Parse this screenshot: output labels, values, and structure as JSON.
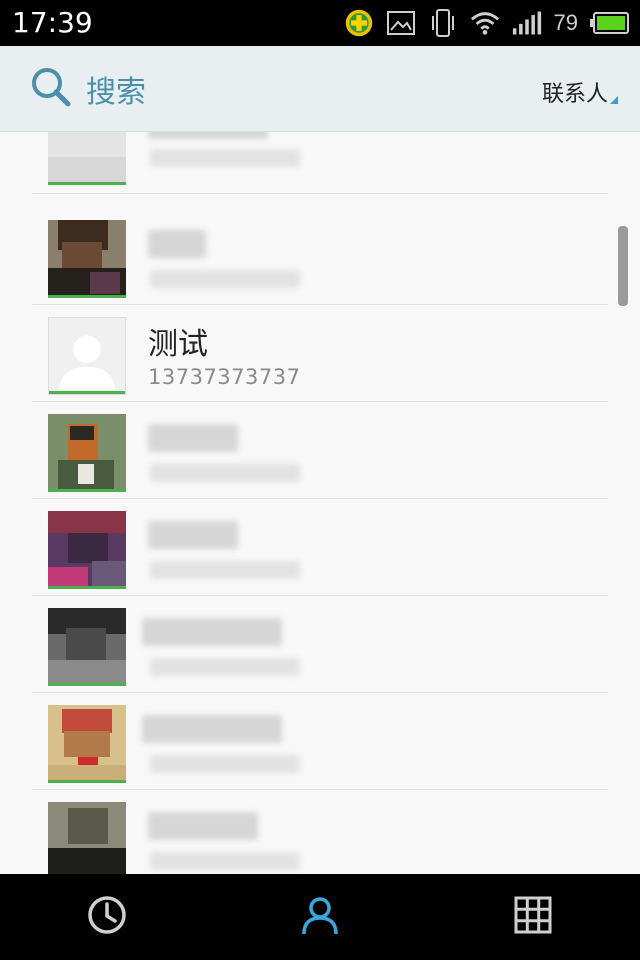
{
  "status_bar": {
    "time": "17:39",
    "battery_level": "79",
    "icons": [
      "security-app-icon",
      "image-icon",
      "vibrate-icon",
      "wifi-icon",
      "signal-icon",
      "battery-icon"
    ]
  },
  "header": {
    "search_label": "搜索",
    "filter_label": "联系人",
    "accent_color": "#4c8faa"
  },
  "contacts": [
    {
      "name": "测试",
      "number": "13737373737"
    }
  ],
  "bottom_nav": {
    "items": [
      "clock-icon",
      "person-icon",
      "grid-icon"
    ],
    "active_color": "#3aa8e0"
  }
}
